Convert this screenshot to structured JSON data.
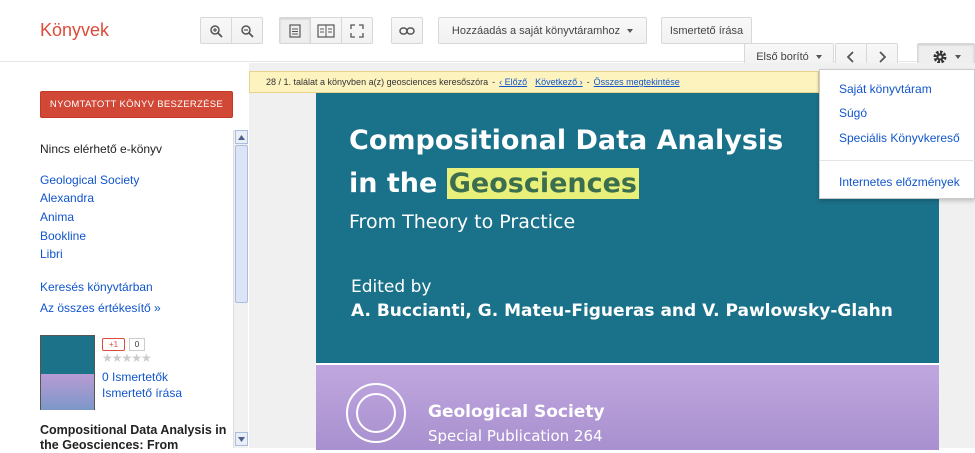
{
  "header": {
    "brand": "Könyvek",
    "add_library": "Hozzáadás a saját könyvtáramhoz",
    "write_review": "Ismertető írása",
    "first_cover": "Első borító"
  },
  "search": {
    "result_text": "28 / 1. találat a könyvben a(z) geosciences keresőszóra",
    "prev": "‹ Előző",
    "next": "Következő ›",
    "show_all": "Összes megtekintése",
    "sep1": "-",
    "sep2": "-"
  },
  "sidebar": {
    "buy_button": "NYOMTATOTT KÖNYV BESZERZÉSE",
    "no_ebook": "Nincs elérhető e-könyv",
    "sellers": [
      "Geological Society",
      "Alexandra",
      "Anima",
      "Bookline",
      "Libri"
    ],
    "library_search": "Keresés könyvtárban",
    "all_sellers": "Az összes értékesítő »",
    "gplus": "+1",
    "gcount": "0",
    "reviews_count": "0 Ismertetők",
    "write_review": "Ismertető írása",
    "book_title": "Compositional Data Analysis in the Geosciences: From"
  },
  "cover": {
    "title_line1": "Compositional Data Analysis",
    "title_line2_prefix": "in the ",
    "title_line2_highlight": "Geosciences",
    "subtitle": "From Theory to Practice",
    "edited_by": "Edited by",
    "authors": "A. Buccianti, G. Mateu-Figueras and V. Pawlowsky-Glahn",
    "publisher": "Geological Society",
    "publication": "Special Publication 264"
  },
  "menu": {
    "items": [
      "Saját könyvtáram",
      "Súgó",
      "Speciális Könyvkereső"
    ],
    "history": "Internetes előzmények"
  },
  "colors": {
    "brand": "#dd4b39",
    "link": "#1155cc",
    "cover_blue": "#1a718a",
    "highlight": "#e9f07a"
  }
}
